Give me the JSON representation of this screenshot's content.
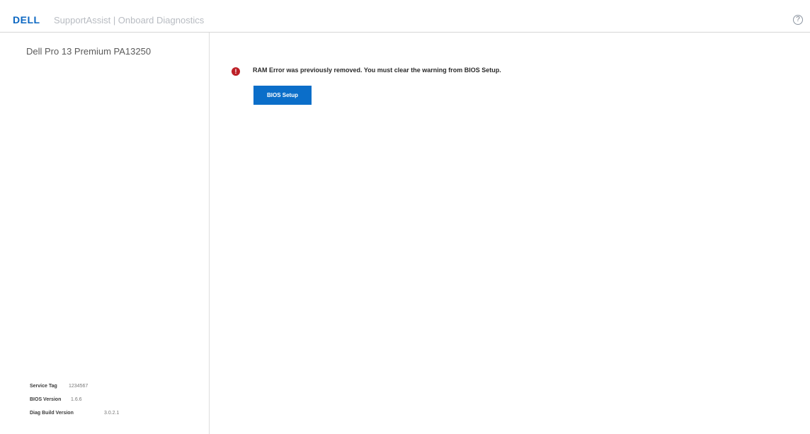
{
  "header": {
    "logo_text": "DELL",
    "app_title": "SupportAssist | Onboard Diagnostics",
    "help_icon": "?"
  },
  "sidebar": {
    "system_name": "Dell Pro 13 Premium PA13250",
    "system_info": [
      {
        "label": "Service Tag",
        "value": "1234567"
      },
      {
        "label": "BIOS Version",
        "value": "1.6.6"
      },
      {
        "label": "Diag Build Version",
        "value": "3.0.2.1"
      }
    ]
  },
  "main": {
    "error_icon": "!",
    "error_message": "RAM Error was previously removed. You must clear the warning from BIOS Setup.",
    "bios_setup_label": "BIOS Setup"
  },
  "colors": {
    "brand_blue": "#0b6ec9",
    "error_red": "#bd2027"
  },
  "icons": {
    "help": "help-icon",
    "error": "error-icon"
  }
}
